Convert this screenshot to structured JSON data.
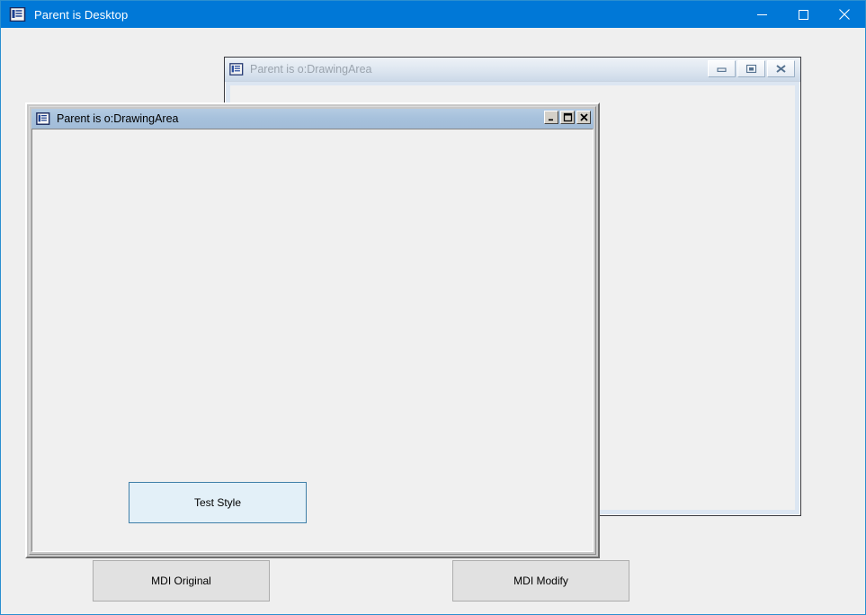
{
  "desktop_window": {
    "title": "Parent is Desktop",
    "icon": "form-window-icon",
    "controls": {
      "minimize": "minimize-icon",
      "maximize": "maximize-icon",
      "close": "close-icon"
    }
  },
  "child_window_back": {
    "title": "Parent is o:DrawingArea",
    "icon": "form-window-icon",
    "state": "inactive",
    "controls": {
      "minimize": "minimize-icon",
      "restore": "restore-icon",
      "close": "close-icon"
    }
  },
  "child_window_front": {
    "title": "Parent is o:DrawingArea",
    "icon": "form-window-icon",
    "state": "active",
    "controls": {
      "minimize": "minimize-icon",
      "maximize": "maximize-icon",
      "close": "close-icon"
    },
    "test_style_button": "Test Style"
  },
  "footer_buttons": [
    {
      "label": "MDI Original"
    },
    {
      "label": "MDI Modify"
    }
  ],
  "colors": {
    "desktop_titlebar": "#0078d7",
    "active_caption": "#a6c1dc",
    "inactive_caption": "#dde6f0",
    "client_background": "#f0f0f0",
    "test_button_fill": "#e3f0f8",
    "test_button_border": "#3f7fa8",
    "window_frame": "#c8c8c8",
    "outer_border": "#2a8fd0"
  }
}
